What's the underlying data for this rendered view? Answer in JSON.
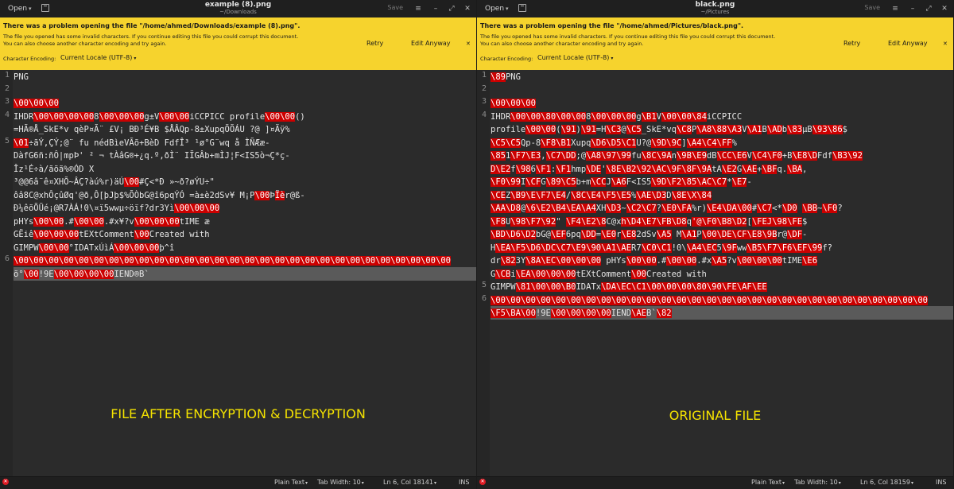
{
  "left": {
    "titlebar": {
      "open_label": "Open",
      "title": "example (8).png",
      "subtitle": "~/Downloads",
      "save_label": "Save",
      "menu_icon": "≡",
      "minimize_icon": "–",
      "restore_icon": "⤢",
      "close_icon": "✕"
    },
    "infobar": {
      "title": "There was a problem opening the file \"/home/ahmed/Downloads/example (8).png\".",
      "msg1": "The file you opened has some invalid characters. If you continue editing this file you could corrupt this document.",
      "msg2": "You can also choose another character encoding and try again.",
      "enc_label": "Character Encoding:",
      "enc_value": "Current Locale (UTF-8)",
      "retry": "Retry",
      "edit_anyway": "Edit Anyway",
      "close": "✕"
    },
    "line_numbers": [
      "1",
      "2",
      "3",
      "4",
      "5",
      "6"
    ],
    "code": [
      [
        {
          "t": "PNG"
        }
      ],
      [
        {
          "t": ""
        }
      ],
      [
        {
          "t": "\\00\\00\\00",
          "r": 1
        }
      ],
      [
        {
          "t": "IHDR"
        },
        {
          "t": "\\00\\00",
          "r": 1
        },
        {
          "t": ""
        },
        {
          "t": "\\00\\00",
          "r": 1
        },
        {
          "t": "8"
        },
        {
          "t": "\\00\\00\\00",
          "r": 1
        },
        {
          "t": "g±V"
        },
        {
          "t": "\\00\\00",
          "r": 1
        },
        {
          "t": "iCCPICC profile"
        },
        {
          "t": "\\00\\00",
          "r": 1
        },
        {
          "t": "()"
        }
      ],
      [
        {
          "t": "=HÃ®Å_SkE*v qèP¤Ã¨ £V¡ BÐ³É¥B $ÅÂQp-8±XupqÖÕÁU ?@  ]¤Äÿ%"
        }
      ],
      [
        {
          "t": "\\01",
          "r": 1
        },
        {
          "t": "÷ãÝ,ÇÝ;@¨ fu nédBìeVÃõ+BèD FdfÎ³  ¹ø°G¨wq å ÌÑÆæ-"
        }
      ],
      [
        {
          "t": "DàfG6ñ:ñÔ|mpÞ' ² ¬ tÀâG®+¿q.º,ðÌ¨ IÏGÂb+mÌJ¦F<IS5ò¬Ç*ç-"
        }
      ],
      [
        {
          "t": "Îz¹É÷à/ãõã%®ÓD X"
        }
      ],
      [
        {
          "t": "³@@6â¨ê¤XHÕ~ÂÇ?àú%r)äÚ"
        },
        {
          "t": "\\00",
          "r": 1
        },
        {
          "t": "#Ç<*Ð »~ð?øÝU÷\""
        }
      ],
      [
        {
          "t": "ôâ8C@xhÔçûØq'@ð,Ô[þJþ$%ÕÒbG@î6pqÝÓ =à±è2dSv¥ M¡P"
        },
        {
          "t": "\\00",
          "r": 1
        },
        {
          "t": "Þ"
        },
        {
          "t": "Ïè",
          "r": 1
        },
        {
          "t": "r@ß-"
        }
      ],
      [
        {
          "t": "Ð¼êõÕÜé¡@R7ÀÁ!0\\¤ï5wwµ÷öïf?dr3Yì"
        },
        {
          "t": "\\00\\00\\00",
          "r": 1
        }
      ],
      [
        {
          "t": "pHYs"
        },
        {
          "t": "\\00\\00",
          "r": 1
        },
        {
          "t": ".#"
        },
        {
          "t": "\\00\\00",
          "r": 1
        },
        {
          "t": ".#x¥?v"
        },
        {
          "t": "\\00\\00\\00",
          "r": 1
        },
        {
          "t": "tIME æ"
        }
      ],
      [
        {
          "t": "GËiê"
        },
        {
          "t": "\\00\\00\\00",
          "r": 1
        },
        {
          "t": "tEXtComment"
        },
        {
          "t": "\\00",
          "r": 1
        },
        {
          "t": "Created with"
        }
      ],
      [
        {
          "t": "GIMPW"
        },
        {
          "t": "\\00\\00",
          "r": 1
        },
        {
          "t": "°IDATxÚìÁ"
        },
        {
          "t": "\\00\\00\\00",
          "r": 1
        },
        {
          "t": "þ^î"
        }
      ],
      [
        {
          "t": "\\00\\00\\00\\00\\00\\00\\00\\00\\00\\00\\00\\00\\00\\00\\00\\00\\00\\00\\00\\00\\00\\00\\00\\00\\00\\00\\00\\00\\00",
          "r": 1
        }
      ],
      [
        {
          "t": "õ°"
        },
        {
          "t": "\\00",
          "r": 1
        },
        {
          "t": "!9E"
        },
        {
          "t": "\\00\\00\\00\\00",
          "r": 1
        },
        {
          "t": "IEND®B`"
        }
      ]
    ],
    "overlay": "FILE AFTER ENCRYPTION & DECRYPTION",
    "status": {
      "lang": "Plain Text",
      "tab": "Tab Width: 10",
      "pos": "Ln 6, Col 18141",
      "mode": "INS"
    }
  },
  "right": {
    "titlebar": {
      "open_label": "Open",
      "title": "black.png",
      "subtitle": "~/Pictures",
      "save_label": "Save",
      "menu_icon": "≡",
      "minimize_icon": "–",
      "restore_icon": "⤢",
      "close_icon": "✕"
    },
    "infobar": {
      "title": "There was a problem opening the file \"/home/ahmed/Pictures/black.png\".",
      "msg1": "The file you opened has some invalid characters. If you continue editing this file you could corrupt this document.",
      "msg2": "You can also choose another character encoding and try again.",
      "enc_label": "Character Encoding:",
      "enc_value": "Current Locale (UTF-8)",
      "retry": "Retry",
      "edit_anyway": "Edit Anyway",
      "close": "✕"
    },
    "line_numbers": [
      "1",
      "2",
      "3",
      "4",
      "5",
      "6"
    ],
    "code": [
      [
        {
          "t": "\\89",
          "r": 1
        },
        {
          "t": "PNG"
        }
      ],
      [
        {
          "t": ""
        }
      ],
      [
        {
          "t": "\\00\\00\\00",
          "r": 1
        }
      ],
      [
        {
          "t": "IHDR"
        },
        {
          "t": "\\00\\00",
          "r": 1
        },
        {
          "t": ""
        },
        {
          "t": "\\80\\00\\00",
          "r": 1
        },
        {
          "t": "8"
        },
        {
          "t": "\\00\\00\\00",
          "r": 1
        },
        {
          "t": "g"
        },
        {
          "t": "\\B1",
          "r": 1
        },
        {
          "t": "V"
        },
        {
          "t": "\\00\\00",
          "r": 1
        },
        {
          "t": ""
        },
        {
          "t": "\\84",
          "r": 1
        },
        {
          "t": "iCCPICC"
        }
      ],
      [
        {
          "t": "profile"
        },
        {
          "t": "\\00\\00",
          "r": 1
        },
        {
          "t": "("
        },
        {
          "t": "\\91",
          "r": 1
        },
        {
          "t": ")"
        },
        {
          "t": "\\91",
          "r": 1
        },
        {
          "t": "=H"
        },
        {
          "t": "\\C3",
          "r": 1
        },
        {
          "t": "@"
        },
        {
          "t": "\\C5",
          "r": 1
        },
        {
          "t": "_SkE*vq"
        },
        {
          "t": "\\C8",
          "r": 1
        },
        {
          "t": "P"
        },
        {
          "t": "\\A8\\88\\A3",
          "r": 1
        },
        {
          "t": "V"
        },
        {
          "t": "\\A1",
          "r": 1
        },
        {
          "t": "B"
        },
        {
          "t": "\\AD",
          "r": 1
        },
        {
          "t": "b"
        },
        {
          "t": "\\83",
          "r": 1
        },
        {
          "t": "µB"
        },
        {
          "t": "\\93\\86",
          "r": 1
        },
        {
          "t": "$"
        }
      ],
      [
        {
          "t": "\\C5\\C5",
          "r": 1
        },
        {
          "t": "Qp-8"
        },
        {
          "t": "\\F8\\B1",
          "r": 1
        },
        {
          "t": "Xupq"
        },
        {
          "t": "\\D6\\D5\\C1",
          "r": 1
        },
        {
          "t": "U?@"
        },
        {
          "t": "\\9D\\9C",
          "r": 1
        },
        {
          "t": "]"
        },
        {
          "t": "\\A4\\C4\\FF",
          "r": 1
        },
        {
          "t": "%"
        }
      ],
      [
        {
          "t": "\\85",
          "r": 1
        },
        {
          "t": "1"
        },
        {
          "t": "\\F7\\E3",
          "r": 1
        },
        {
          "t": ","
        },
        {
          "t": "\\C7\\DD",
          "r": 1
        },
        {
          "t": ";@"
        },
        {
          "t": "\\A8\\97\\99",
          "r": 1
        },
        {
          "t": "fu"
        },
        {
          "t": "\\8C",
          "r": 1
        },
        {
          "t": ""
        },
        {
          "t": "\\9A",
          "r": 1
        },
        {
          "t": "n"
        },
        {
          "t": "\\9B\\E9",
          "r": 1
        },
        {
          "t": "dB"
        },
        {
          "t": "\\CC\\E6",
          "r": 1
        },
        {
          "t": "V"
        },
        {
          "t": "\\C4\\F0",
          "r": 1
        },
        {
          "t": "+B"
        },
        {
          "t": "\\E8\\D",
          "r": 1
        },
        {
          "t": "Fdf"
        },
        {
          "t": "\\B3\\92",
          "r": 1
        }
      ],
      [
        {
          "t": "D\\E2",
          "r": 1
        },
        {
          "t": "f"
        },
        {
          "t": "\\98",
          "r": 1
        },
        {
          "t": "6"
        },
        {
          "t": "\\F1",
          "r": 1
        },
        {
          "t": ":"
        },
        {
          "t": "\\F1",
          "r": 1
        },
        {
          "t": "hmp"
        },
        {
          "t": "\\DE",
          "r": 1
        },
        {
          "t": "'"
        },
        {
          "t": "\\8E\\B2\\92\\AC",
          "r": 1
        },
        {
          "t": ""
        },
        {
          "t": "\\9F",
          "r": 1
        },
        {
          "t": ""
        },
        {
          "t": "\\8F\\9A",
          "r": 1
        },
        {
          "t": "tA"
        },
        {
          "t": "\\E2",
          "r": 1
        },
        {
          "t": "G"
        },
        {
          "t": "\\AE",
          "r": 1
        },
        {
          "t": "+"
        },
        {
          "t": "\\BF",
          "r": 1
        },
        {
          "t": "q."
        },
        {
          "t": "\\BA",
          "r": 1
        },
        {
          "t": ","
        }
      ],
      [
        {
          "t": "\\F0\\99",
          "r": 1
        },
        {
          "t": "I"
        },
        {
          "t": "\\CF",
          "r": 1
        },
        {
          "t": "G"
        },
        {
          "t": "\\89\\C5",
          "r": 1
        },
        {
          "t": "b"
        },
        {
          "t": "+m"
        },
        {
          "t": "\\CC",
          "r": 1
        },
        {
          "t": "J"
        },
        {
          "t": "\\A6",
          "r": 1
        },
        {
          "t": "F<IS5"
        },
        {
          "t": "\\9D\\F2\\85\\AC\\C7",
          "r": 1
        },
        {
          "t": "*"
        },
        {
          "t": "\\E7",
          "r": 1
        },
        {
          "t": "-"
        }
      ],
      [
        {
          "t": "\\CE",
          "r": 1
        },
        {
          "t": "Z"
        },
        {
          "t": "\\B9\\E\\F7\\E4",
          "r": 1
        },
        {
          "t": "/"
        },
        {
          "t": "\\8C\\E4\\F5\\E5",
          "r": 1
        },
        {
          "t": "%"
        },
        {
          "t": "\\AE\\D3",
          "r": 1
        },
        {
          "t": "D"
        },
        {
          "t": "\\8E\\X\\84",
          "r": 1
        }
      ],
      [
        {
          "t": "\\AA\\D8",
          "r": 1
        },
        {
          "t": "@"
        },
        {
          "t": "\\6\\E2\\B4\\EA\\A4",
          "r": 1
        },
        {
          "t": "XH"
        },
        {
          "t": "\\D3",
          "r": 1
        },
        {
          "t": "~"
        },
        {
          "t": "\\C2\\C7",
          "r": 1
        },
        {
          "t": "?"
        },
        {
          "t": "\\E0\\FA",
          "r": 1
        },
        {
          "t": "%r)"
        },
        {
          "t": "\\E4\\DA\\00",
          "r": 1
        },
        {
          "t": "#"
        },
        {
          "t": "\\C7",
          "r": 1
        },
        {
          "t": "<*"
        },
        {
          "t": "\\D0",
          "r": 1
        },
        {
          "t": " "
        },
        {
          "t": "\\BB",
          "r": 1
        },
        {
          "t": "~"
        },
        {
          "t": "\\F0",
          "r": 1
        },
        {
          "t": "?"
        }
      ],
      [
        {
          "t": "\\F8",
          "r": 1
        },
        {
          "t": "U"
        },
        {
          "t": "\\98",
          "r": 1
        },
        {
          "t": ""
        },
        {
          "t": "\\F7\\92",
          "r": 1
        },
        {
          "t": "\"    "
        },
        {
          "t": "\\F4\\E2\\8",
          "r": 1
        },
        {
          "t": "C@x"
        },
        {
          "t": "h\\D4",
          "r": 1
        },
        {
          "t": ""
        },
        {
          "t": "\\E7\\FB\\D8",
          "r": 1
        },
        {
          "t": "q"
        },
        {
          "t": "'@\\F0",
          "r": 1
        },
        {
          "t": ""
        },
        {
          "t": "\\B8\\D2",
          "r": 1
        },
        {
          "t": "["
        },
        {
          "t": "\\FEJ",
          "r": 1
        },
        {
          "t": ""
        },
        {
          "t": "\\98\\FE",
          "r": 1
        },
        {
          "t": "$"
        }
      ],
      [
        {
          "t": "\\BD\\D6\\D2",
          "r": 1
        },
        {
          "t": "bG@"
        },
        {
          "t": "\\EF",
          "r": 1
        },
        {
          "t": "6pq"
        },
        {
          "t": "\\DD",
          "r": 1
        },
        {
          "t": "="
        },
        {
          "t": "\\E0",
          "r": 1
        },
        {
          "t": "r"
        },
        {
          "t": "\\E8",
          "r": 1
        },
        {
          "t": "2dSv"
        },
        {
          "t": "\\A5",
          "r": 1
        },
        {
          "t": " M"
        },
        {
          "t": "\\A1",
          "r": 1
        },
        {
          "t": "P"
        },
        {
          "t": "\\00\\DE\\CF\\E8\\9B",
          "r": 1
        },
        {
          "t": "r@"
        },
        {
          "t": "\\DF",
          "r": 1
        },
        {
          "t": "-"
        }
      ],
      [
        {
          "t": "H"
        },
        {
          "t": "\\EA\\F5\\D6\\DC\\C7\\E9",
          "r": 1
        },
        {
          "t": ""
        },
        {
          "t": "\\90\\A1\\AE",
          "r": 1
        },
        {
          "t": "R7"
        },
        {
          "t": "\\C0\\C1",
          "r": 1
        },
        {
          "t": "!0\\"
        },
        {
          "t": "\\A4\\EC",
          "r": 1
        },
        {
          "t": "5"
        },
        {
          "t": "\\9F",
          "r": 1
        },
        {
          "t": "ww"
        },
        {
          "t": "\\B5\\F7\\F6\\EF\\99",
          "r": 1
        },
        {
          "t": "f?"
        }
      ],
      [
        {
          "t": "dr"
        },
        {
          "t": "\\82",
          "r": 1
        },
        {
          "t": "3Y"
        },
        {
          "t": "\\8A\\EC\\00\\00\\00",
          "r": 1
        },
        {
          "t": "        pHYs"
        },
        {
          "t": "\\00\\00",
          "r": 1
        },
        {
          "t": ".#"
        },
        {
          "t": "\\00\\00",
          "r": 1
        },
        {
          "t": ".#x"
        },
        {
          "t": "\\A5",
          "r": 1
        },
        {
          "t": "?v"
        },
        {
          "t": "\\00\\00\\00",
          "r": 1
        },
        {
          "t": "tIME"
        },
        {
          "t": "\\E6",
          "r": 1
        }
      ],
      [
        {
          "t": "G"
        },
        {
          "t": "\\CB",
          "r": 1
        },
        {
          "t": "i"
        },
        {
          "t": "\\EA\\00\\00\\00",
          "r": 1
        },
        {
          "t": "tEXtComment"
        },
        {
          "t": "\\00",
          "r": 1
        },
        {
          "t": "Created with"
        }
      ],
      [
        {
          "t": "GIMPW"
        },
        {
          "t": "\\81",
          "r": 1
        },
        {
          "t": ""
        },
        {
          "t": "\\00\\00",
          "r": 1
        },
        {
          "t": ""
        },
        {
          "t": "\\B0",
          "r": 1
        },
        {
          "t": "IDATx"
        },
        {
          "t": "\\DA\\EC\\C1",
          "r": 1
        },
        {
          "t": ""
        },
        {
          "t": "\\00\\00\\00\\80\\90\\FE\\AF\\EE",
          "r": 1
        }
      ],
      [
        {
          "t": "\\00\\00\\00\\00\\00\\00\\00\\00\\00\\00\\00\\00\\00\\00\\00\\00\\00\\00\\00\\00\\00\\00\\00\\00\\00\\00\\00\\00\\00",
          "r": 1
        }
      ],
      [
        {
          "t": "                                                         "
        },
        {
          "t": "\\F5\\BA\\00",
          "r": 1
        },
        {
          "t": "!9E"
        },
        {
          "t": "\\00\\00\\00\\00",
          "r": 1
        },
        {
          "t": "IEND"
        },
        {
          "t": "\\AE",
          "r": 1
        },
        {
          "t": "B`"
        },
        {
          "t": "\\82",
          "r": 1
        }
      ]
    ],
    "overlay": "ORIGINAL FILE",
    "status": {
      "lang": "Plain Text",
      "tab": "Tab Width: 10",
      "pos": "Ln 6, Col 18159",
      "mode": "INS"
    }
  }
}
